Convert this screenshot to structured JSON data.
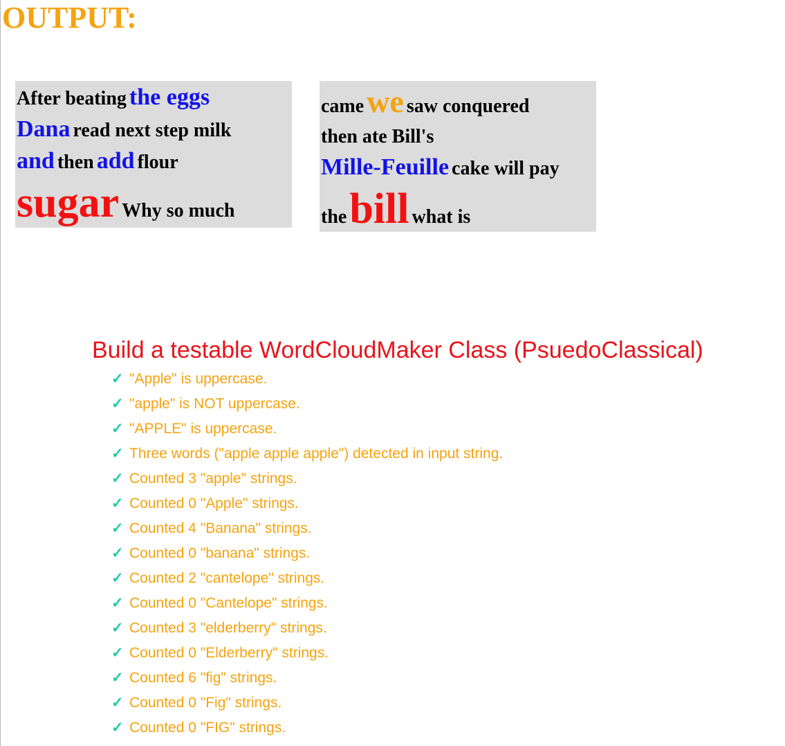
{
  "output_heading": "OUTPUT:",
  "cloud_a": {
    "lines": [
      [
        {
          "text": "After beating",
          "color": "black",
          "size": "md"
        },
        {
          "text": "the eggs",
          "color": "blue",
          "size": "lg"
        }
      ],
      [
        {
          "text": "Dana",
          "color": "blue",
          "size": "lg"
        },
        {
          "text": "read next step milk",
          "color": "black",
          "size": "md"
        }
      ],
      [
        {
          "text": "and",
          "color": "blue",
          "size": "lg"
        },
        {
          "text": "then",
          "color": "black",
          "size": "md"
        },
        {
          "text": "add",
          "color": "blue",
          "size": "lg"
        },
        {
          "text": "flour",
          "color": "black",
          "size": "md"
        }
      ],
      [
        {
          "text": "sugar",
          "color": "red",
          "size": "xxl"
        },
        {
          "text": "Why so much",
          "color": "black",
          "size": "md"
        }
      ]
    ]
  },
  "cloud_b": {
    "lines": [
      [
        {
          "text": "came",
          "color": "black",
          "size": "md"
        },
        {
          "text": "we",
          "color": "orange",
          "size": "xl"
        },
        {
          "text": "saw conquered",
          "color": "black",
          "size": "md"
        }
      ],
      [
        {
          "text": "then ate Bill's",
          "color": "black",
          "size": "md"
        }
      ],
      [
        {
          "text": "Mille-Feuille",
          "color": "blue",
          "size": "lg"
        },
        {
          "text": "cake will pay",
          "color": "black",
          "size": "md"
        }
      ],
      [
        {
          "text": "the",
          "color": "black",
          "size": "md"
        },
        {
          "text": "bill",
          "color": "red",
          "size": "xxl"
        },
        {
          "text": "what is",
          "color": "black",
          "size": "md"
        }
      ]
    ]
  },
  "tests": {
    "title": "Build a testable WordCloudMaker Class (PsuedoClassical)",
    "check_glyph": "✓",
    "items": [
      "\"Apple\" is uppercase.",
      "\"apple\" is NOT uppercase.",
      "\"APPLE\" is uppercase.",
      "Three words (\"apple apple apple\") detected in input string.",
      "Counted 3 \"apple\" strings.",
      "Counted 0 \"Apple\" strings.",
      "Counted 4 \"Banana\" strings.",
      "Counted 0 \"banana\" strings.",
      "Counted 2 \"cantelope\" strings.",
      "Counted 0 \"Cantelope\" strings.",
      "Counted 3 \"elderberry\" strings.",
      "Counted 0 \"Elderberry\" strings.",
      "Counted 6 \"fig\" strings.",
      "Counted 0 \"Fig\" strings.",
      "Counted 0 \"FIG\" strings."
    ]
  },
  "colors": {
    "heading": "#f5a30e",
    "cloud_bg": "#dcdcdc",
    "blue": "#1212e8",
    "red": "#f21111",
    "orange": "#f5a30e",
    "test_title": "#e8141a",
    "test_item": "#f5a30e",
    "check": "#20c9a8"
  }
}
